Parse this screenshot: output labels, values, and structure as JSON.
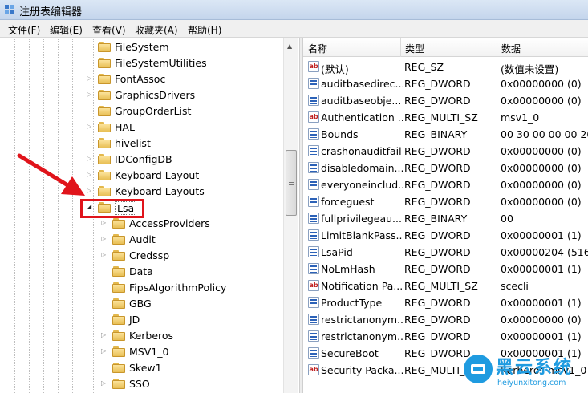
{
  "window": {
    "title": "注册表编辑器"
  },
  "menu": [
    {
      "label": "文件(F)"
    },
    {
      "label": "编辑(E)"
    },
    {
      "label": "查看(V)"
    },
    {
      "label": "收藏夹(A)"
    },
    {
      "label": "帮助(H)"
    }
  ],
  "tree": {
    "selected": "Lsa",
    "nodes": [
      {
        "label": "FileSystem",
        "expander": ""
      },
      {
        "label": "FileSystemUtilities",
        "expander": ""
      },
      {
        "label": "FontAssoc",
        "expander": "▷"
      },
      {
        "label": "GraphicsDrivers",
        "expander": "▷"
      },
      {
        "label": "GroupOrderList",
        "expander": ""
      },
      {
        "label": "HAL",
        "expander": "▷"
      },
      {
        "label": "hivelist",
        "expander": ""
      },
      {
        "label": "IDConfigDB",
        "expander": "▷"
      },
      {
        "label": "Keyboard Layout",
        "expander": "▷"
      },
      {
        "label": "Keyboard Layouts",
        "expander": "▷"
      },
      {
        "label": "Lsa",
        "expander": "◢"
      },
      {
        "label": "AccessProviders",
        "expander": "▷"
      },
      {
        "label": "Audit",
        "expander": "▷"
      },
      {
        "label": "Credssp",
        "expander": "▷"
      },
      {
        "label": "Data",
        "expander": ""
      },
      {
        "label": "FipsAlgorithmPolicy",
        "expander": ""
      },
      {
        "label": "GBG",
        "expander": ""
      },
      {
        "label": "JD",
        "expander": ""
      },
      {
        "label": "Kerberos",
        "expander": "▷"
      },
      {
        "label": "MSV1_0",
        "expander": "▷"
      },
      {
        "label": "Skew1",
        "expander": ""
      },
      {
        "label": "SSO",
        "expander": "▷"
      }
    ]
  },
  "list": {
    "columns": [
      {
        "label": "名称"
      },
      {
        "label": "类型"
      },
      {
        "label": "数据"
      }
    ],
    "rows": [
      {
        "icon": "string-value-icon",
        "name": "(默认)",
        "type": "REG_SZ",
        "data": "(数值未设置)"
      },
      {
        "icon": "binary-value-icon",
        "name": "auditbasedirec...",
        "type": "REG_DWORD",
        "data": "0x00000000 (0)"
      },
      {
        "icon": "binary-value-icon",
        "name": "auditbaseobje...",
        "type": "REG_DWORD",
        "data": "0x00000000 (0)"
      },
      {
        "icon": "string-value-icon",
        "name": "Authentication ...",
        "type": "REG_MULTI_SZ",
        "data": "msv1_0"
      },
      {
        "icon": "binary-value-icon",
        "name": "Bounds",
        "type": "REG_BINARY",
        "data": "00 30 00 00 00 20 0"
      },
      {
        "icon": "binary-value-icon",
        "name": "crashonauditfail",
        "type": "REG_DWORD",
        "data": "0x00000000 (0)"
      },
      {
        "icon": "binary-value-icon",
        "name": "disabledomain...",
        "type": "REG_DWORD",
        "data": "0x00000000 (0)"
      },
      {
        "icon": "binary-value-icon",
        "name": "everyoneinclud...",
        "type": "REG_DWORD",
        "data": "0x00000000 (0)"
      },
      {
        "icon": "binary-value-icon",
        "name": "forceguest",
        "type": "REG_DWORD",
        "data": "0x00000000 (0)"
      },
      {
        "icon": "binary-value-icon",
        "name": "fullprivilegeau...",
        "type": "REG_BINARY",
        "data": "00"
      },
      {
        "icon": "binary-value-icon",
        "name": "LimitBlankPass...",
        "type": "REG_DWORD",
        "data": "0x00000001 (1)"
      },
      {
        "icon": "binary-value-icon",
        "name": "LsaPid",
        "type": "REG_DWORD",
        "data": "0x00000204 (516)"
      },
      {
        "icon": "binary-value-icon",
        "name": "NoLmHash",
        "type": "REG_DWORD",
        "data": "0x00000001 (1)"
      },
      {
        "icon": "string-value-icon",
        "name": "Notification Pa...",
        "type": "REG_MULTI_SZ",
        "data": "scecli"
      },
      {
        "icon": "binary-value-icon",
        "name": "ProductType",
        "type": "REG_DWORD",
        "data": "0x00000001 (1)"
      },
      {
        "icon": "binary-value-icon",
        "name": "restrictanonym...",
        "type": "REG_DWORD",
        "data": "0x00000000 (0)"
      },
      {
        "icon": "binary-value-icon",
        "name": "restrictanonym...",
        "type": "REG_DWORD",
        "data": "0x00000001 (1)"
      },
      {
        "icon": "binary-value-icon",
        "name": "SecureBoot",
        "type": "REG_DWORD",
        "data": "0x00000001 (1)"
      },
      {
        "icon": "string-value-icon",
        "name": "Security Packa...",
        "type": "REG_MULTI_SZ",
        "data": "Kerberos msv1_0 s"
      }
    ]
  },
  "watermark": {
    "title": "黑云系统",
    "url": "heiyunxitong.com"
  },
  "colors": {
    "highlight": "#e0141b",
    "arrow": "#e0141b",
    "watermark": "#1f9be0"
  }
}
